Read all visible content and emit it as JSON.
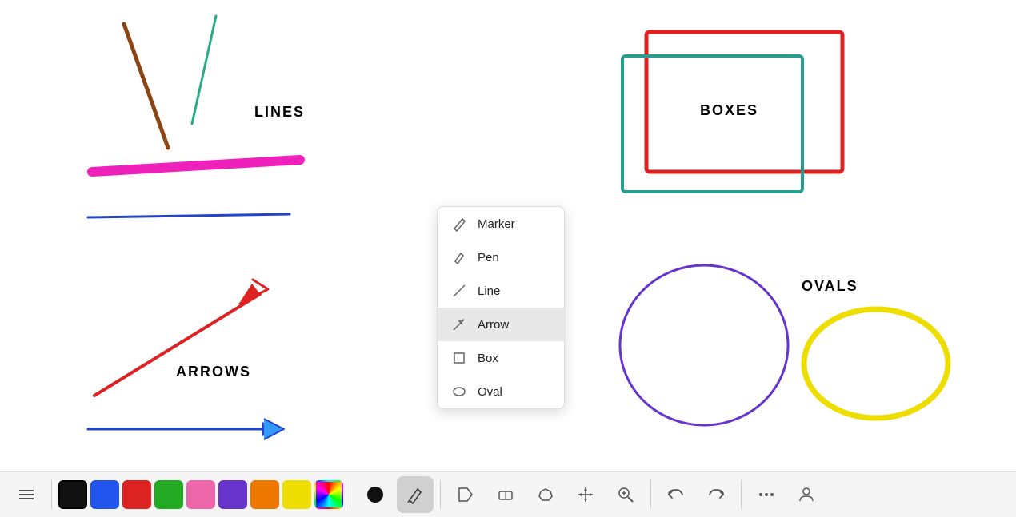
{
  "canvas": {
    "background": "#ffffff"
  },
  "labels": {
    "lines": "LINES",
    "arrows": "ARROWS",
    "boxes": "BOXES",
    "ovals": "OVALS"
  },
  "dropdown": {
    "items": [
      {
        "id": "marker",
        "label": "Marker"
      },
      {
        "id": "pen",
        "label": "Pen"
      },
      {
        "id": "line",
        "label": "Line"
      },
      {
        "id": "arrow",
        "label": "Arrow",
        "selected": true
      },
      {
        "id": "box",
        "label": "Box"
      },
      {
        "id": "oval",
        "label": "Oval"
      }
    ]
  },
  "toolbar": {
    "colors": [
      {
        "id": "black",
        "hex": "#111111",
        "active": true
      },
      {
        "id": "blue",
        "hex": "#2255ee"
      },
      {
        "id": "red",
        "hex": "#dd2222"
      },
      {
        "id": "green",
        "hex": "#22aa22"
      },
      {
        "id": "pink",
        "hex": "#ee66aa"
      },
      {
        "id": "purple",
        "hex": "#6633cc"
      },
      {
        "id": "orange",
        "hex": "#ee7700"
      },
      {
        "id": "yellow",
        "hex": "#eedd00"
      },
      {
        "id": "multi",
        "hex": "multi"
      }
    ],
    "buttons": [
      {
        "id": "menu",
        "icon": "≡"
      },
      {
        "id": "circle-fill",
        "icon": "●"
      },
      {
        "id": "pen-active",
        "icon": "✏"
      },
      {
        "id": "label",
        "icon": "🏷"
      },
      {
        "id": "eraser",
        "icon": "⬜"
      },
      {
        "id": "lasso",
        "icon": "⬡"
      },
      {
        "id": "move",
        "icon": "✛"
      },
      {
        "id": "zoom",
        "icon": "🔍"
      },
      {
        "id": "undo",
        "icon": "↩"
      },
      {
        "id": "redo",
        "icon": "↪"
      },
      {
        "id": "more",
        "icon": "•••"
      },
      {
        "id": "profile",
        "icon": "👤"
      }
    ]
  }
}
